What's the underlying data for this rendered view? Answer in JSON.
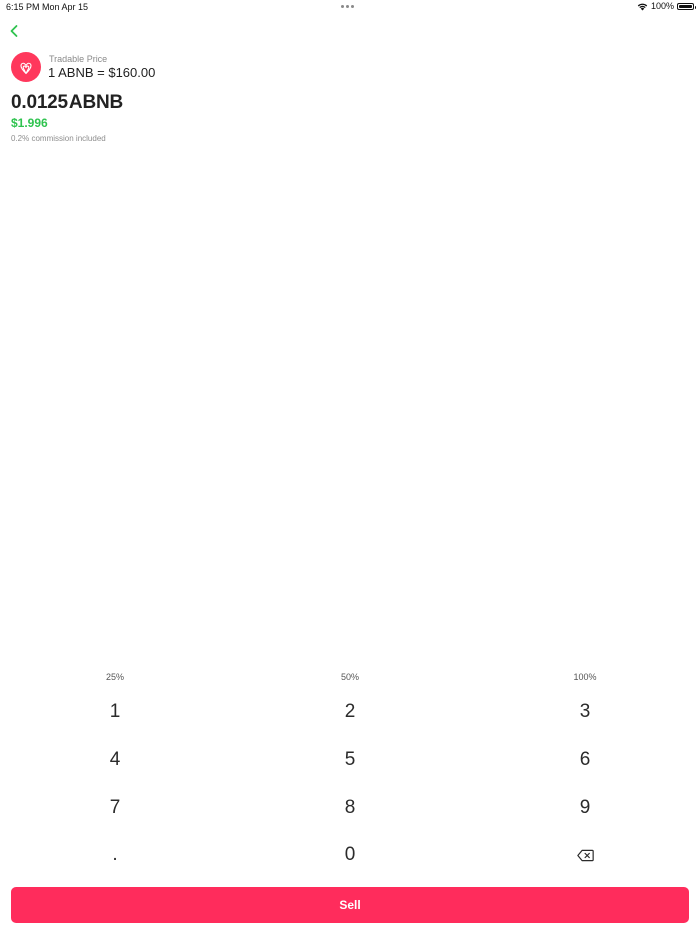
{
  "status_bar": {
    "time": "6:15 PM",
    "date": "Mon Apr 15",
    "battery_text": "100%",
    "battery_level": 1.0,
    "wifi_icon": "wifi-icon",
    "battery_icon": "battery-icon"
  },
  "nav": {
    "back_icon": "chevron-left-icon",
    "accent_color": "#2fc34f"
  },
  "asset": {
    "logo_icon": "airbnb-logo-icon",
    "logo_color": "#ff385c",
    "price_label": "Tradable Price",
    "price_value": "1 ABNB = $160.00"
  },
  "order": {
    "amount_value": "0.0125",
    "amount_unit": "ABNB",
    "usd_value": "$1.996",
    "commission_note": "0.2% commission included"
  },
  "quick_percent": [
    "25%",
    "50%",
    "100%"
  ],
  "keypad": {
    "keys": [
      "1",
      "2",
      "3",
      "4",
      "5",
      "6",
      "7",
      "8",
      "9",
      ".",
      "0"
    ],
    "backspace_icon": "backspace-icon"
  },
  "sell_button": {
    "label": "Sell",
    "color": "#ff2c5c"
  }
}
